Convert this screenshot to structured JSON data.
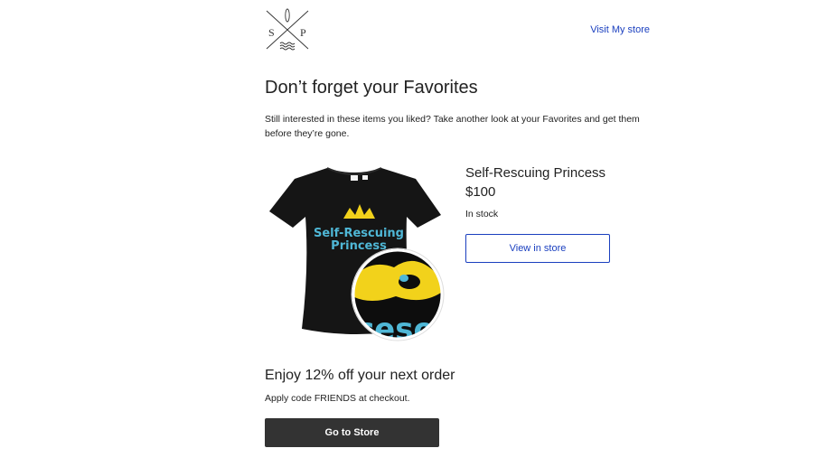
{
  "header": {
    "logo": {
      "left_letter": "S",
      "right_letter": "P"
    },
    "visit_link": "Visit My store"
  },
  "headline": "Don’t forget your Favorites",
  "intro": "Still interested in these items you liked? Take another look at your Favorites and get them before they’re gone.",
  "product": {
    "image_text_line1": "Self-Rescuing",
    "image_text_line2": "Princess",
    "title": "Self-Rescuing Princess",
    "price": "$100",
    "stock": "In stock",
    "view_button": "View in store"
  },
  "promo": {
    "title": "Enjoy 12% off your next order",
    "text": "Apply code FRIENDS at checkout.",
    "button": "Go to Store"
  },
  "colors": {
    "link": "#1a3fbf",
    "dark_button": "#333333",
    "shirt": "#151515",
    "crown": "#f2d21b",
    "print_text": "#4fb7d6"
  }
}
